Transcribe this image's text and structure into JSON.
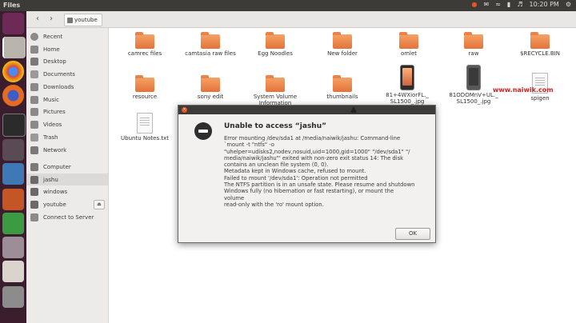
{
  "topbar": {
    "app_title": "Files",
    "time": "10:20 PM",
    "icons": [
      "record-icon",
      "mail-icon",
      "wifi-icon",
      "battery-icon",
      "volume-icon",
      "gear-icon"
    ]
  },
  "toolbar": {
    "back_icon": "‹",
    "forward_icon": "›",
    "breadcrumb_label": "youtube"
  },
  "sidebar": {
    "items": [
      {
        "label": "Recent",
        "icon": "clock-icon"
      },
      {
        "label": "Home",
        "icon": "home-icon"
      },
      {
        "label": "Desktop",
        "icon": "desktop-icon"
      },
      {
        "label": "Documents",
        "icon": "documents-icon"
      },
      {
        "label": "Downloads",
        "icon": "downloads-icon"
      },
      {
        "label": "Music",
        "icon": "music-icon"
      },
      {
        "label": "Pictures",
        "icon": "pictures-icon"
      },
      {
        "label": "Videos",
        "icon": "videos-icon"
      },
      {
        "label": "Trash",
        "icon": "trash-icon"
      },
      {
        "label": "Network",
        "icon": "network-icon"
      },
      {
        "label": "Computer",
        "icon": "computer-icon"
      },
      {
        "label": "jashu",
        "icon": "drive-icon"
      },
      {
        "label": "windows",
        "icon": "drive-icon"
      },
      {
        "label": "youtube",
        "icon": "drive-icon"
      },
      {
        "label": "Connect to Server",
        "icon": "server-icon"
      }
    ],
    "eject_glyph": "⏏"
  },
  "files": [
    {
      "name": "camrec files",
      "kind": "folder"
    },
    {
      "name": "camtasia raw files",
      "kind": "folder"
    },
    {
      "name": "Egg Noodles",
      "kind": "folder"
    },
    {
      "name": "New folder",
      "kind": "folder"
    },
    {
      "name": "omlet",
      "kind": "folder"
    },
    {
      "name": "raw",
      "kind": "folder"
    },
    {
      "name": "$RECYCLE.BIN",
      "kind": "folder"
    },
    {
      "name": "resource",
      "kind": "folder"
    },
    {
      "name": "sony edit",
      "kind": "folder"
    },
    {
      "name": "System Volume",
      "name2": "Information",
      "kind": "folder"
    },
    {
      "name": "thumbnails",
      "kind": "folder"
    },
    {
      "name": "81+4WXiorFL._",
      "name2": "SL1500_.jpg",
      "kind": "image"
    },
    {
      "name": "81ODOMnV+UL._",
      "name2": "SL1500_.jpg",
      "kind": "image"
    },
    {
      "name": "spigen",
      "kind": "doc"
    },
    {
      "name": "Ubuntu Notes.txt",
      "kind": "doc"
    }
  ],
  "watermark": "www.naiwik.com",
  "dialog": {
    "close_glyph": "×",
    "heading": "Unable to access “jashu”",
    "lines": [
      "Error mounting /dev/sda1 at /media/naiwik/jashu: Command-line",
      "`mount -t \"ntfs\" -o",
      "\"uhelper=udisks2,nodev,nosuid,uid=1000,gid=1000\" \"/dev/sda1\" \"/",
      "media/naiwik/jashu\"' exited with non-zero exit status 14: The disk",
      "contains an unclean file system (0, 0).",
      "Metadata kept in Windows cache, refused to mount.",
      "Failed to mount '/dev/sda1': Operation not permitted",
      "The NTFS partition is in an unsafe state. Please resume and shutdown",
      "Windows fully (no hibernation or fast restarting), or mount the",
      "volume",
      "read-only with the 'ro' mount option."
    ],
    "ok_label": "OK"
  },
  "colors": {
    "launcher_bg": "#3a1e2e",
    "folder_orange": "#e4733a",
    "titlebar": "#3c3b37",
    "close_button": "#e95420"
  }
}
